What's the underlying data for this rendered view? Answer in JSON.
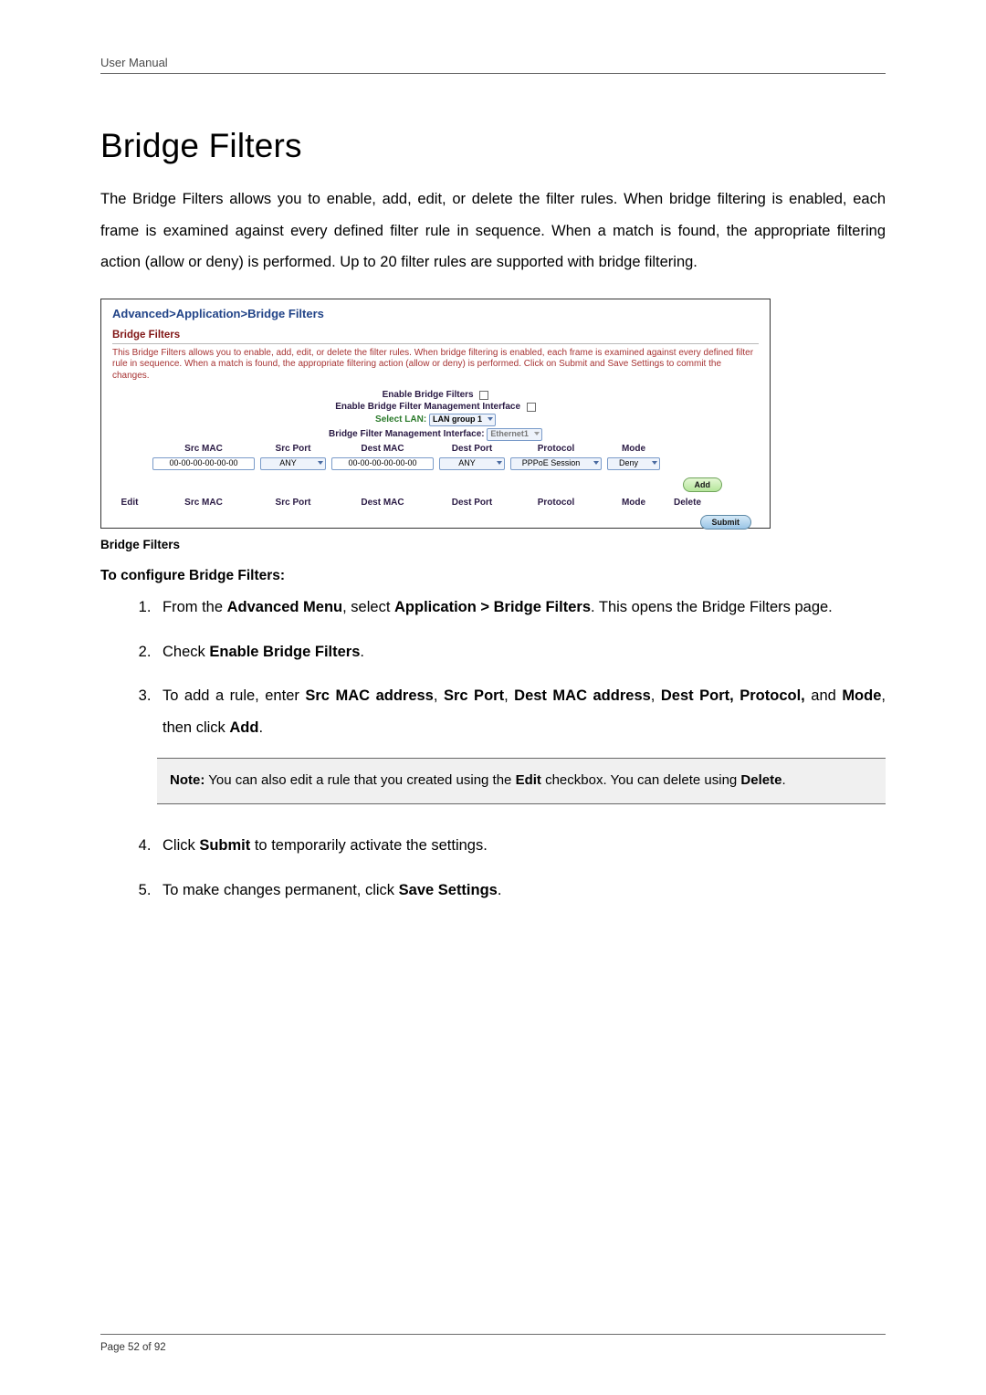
{
  "header": {
    "label": "User Manual"
  },
  "footer": {
    "page_text": "Page 52 of 92"
  },
  "title": "Bridge Filters",
  "intro": "The Bridge Filters allows you to enable, add, edit, or delete the filter rules. When bridge filtering is enabled, each frame is examined against every defined filter rule in sequence. When a match is found, the appropriate filtering action (allow or deny) is performed. Up to 20 filter rules are supported with bridge filtering.",
  "screenshot": {
    "breadcrumb": "Advanced>Application>Bridge Filters",
    "panel_title": "Bridge Filters",
    "description": "This Bridge Filters allows you to enable, add, edit, or delete the filter rules. When bridge filtering is enabled, each frame is examined against every defined filter rule in sequence. When a match is found, the appropriate filtering action (allow or deny) is performed. Click on Submit and Save Settings to commit the changes.",
    "opts": {
      "enable_label": "Enable Bridge Filters",
      "mgmt_iface_label": "Enable Bridge Filter Management Interface",
      "select_lan_label": "Select LAN:",
      "select_lan_value": "LAN group 1",
      "bfmi_label": "Bridge Filter Management Interface:",
      "bfmi_value": "Ethernet1"
    },
    "cols": {
      "edit": "Edit",
      "src_mac": "Src MAC",
      "src_port": "Src Port",
      "dest_mac": "Dest MAC",
      "dest_port": "Dest Port",
      "protocol": "Protocol",
      "mode": "Mode",
      "delete": "Delete"
    },
    "entry": {
      "src_mac": "00-00-00-00-00-00",
      "src_port": "ANY",
      "dest_mac": "00-00-00-00-00-00",
      "dest_port": "ANY",
      "protocol": "PPPoE Session",
      "mode": "Deny"
    },
    "add_btn": "Add",
    "submit_btn": "Submit"
  },
  "caption": "Bridge Filters",
  "subhead": "To configure Bridge Filters:",
  "steps": {
    "s1_a": "From the ",
    "s1_b": "Advanced Menu",
    "s1_c": ", select ",
    "s1_d": "Application > Bridge Filters",
    "s1_e": ". This opens the Bridge Filters page.",
    "s2_a": "Check ",
    "s2_b": "Enable Bridge Filters",
    "s2_c": ".",
    "s3_a": "To add a rule, enter ",
    "s3_b": "Src MAC address",
    "s3_c": ", ",
    "s3_d": "Src Port",
    "s3_e": ", ",
    "s3_f": "Dest MAC address",
    "s3_g": ", ",
    "s3_h": "Dest Port, Protocol,",
    "s3_i": " and ",
    "s3_j": "Mode",
    "s3_k": ", then click ",
    "s3_l": "Add",
    "s3_m": ".",
    "s4_a": "Click ",
    "s4_b": "Submit",
    "s4_c": " to temporarily activate the settings.",
    "s5_a": "To make changes permanent, click ",
    "s5_b": "Save Settings",
    "s5_c": "."
  },
  "note": {
    "n_a": "Note:",
    "n_b": " You can also edit a rule that you created using the ",
    "n_c": "Edit",
    "n_d": " checkbox. You can delete using ",
    "n_e": "Delete",
    "n_f": "."
  }
}
